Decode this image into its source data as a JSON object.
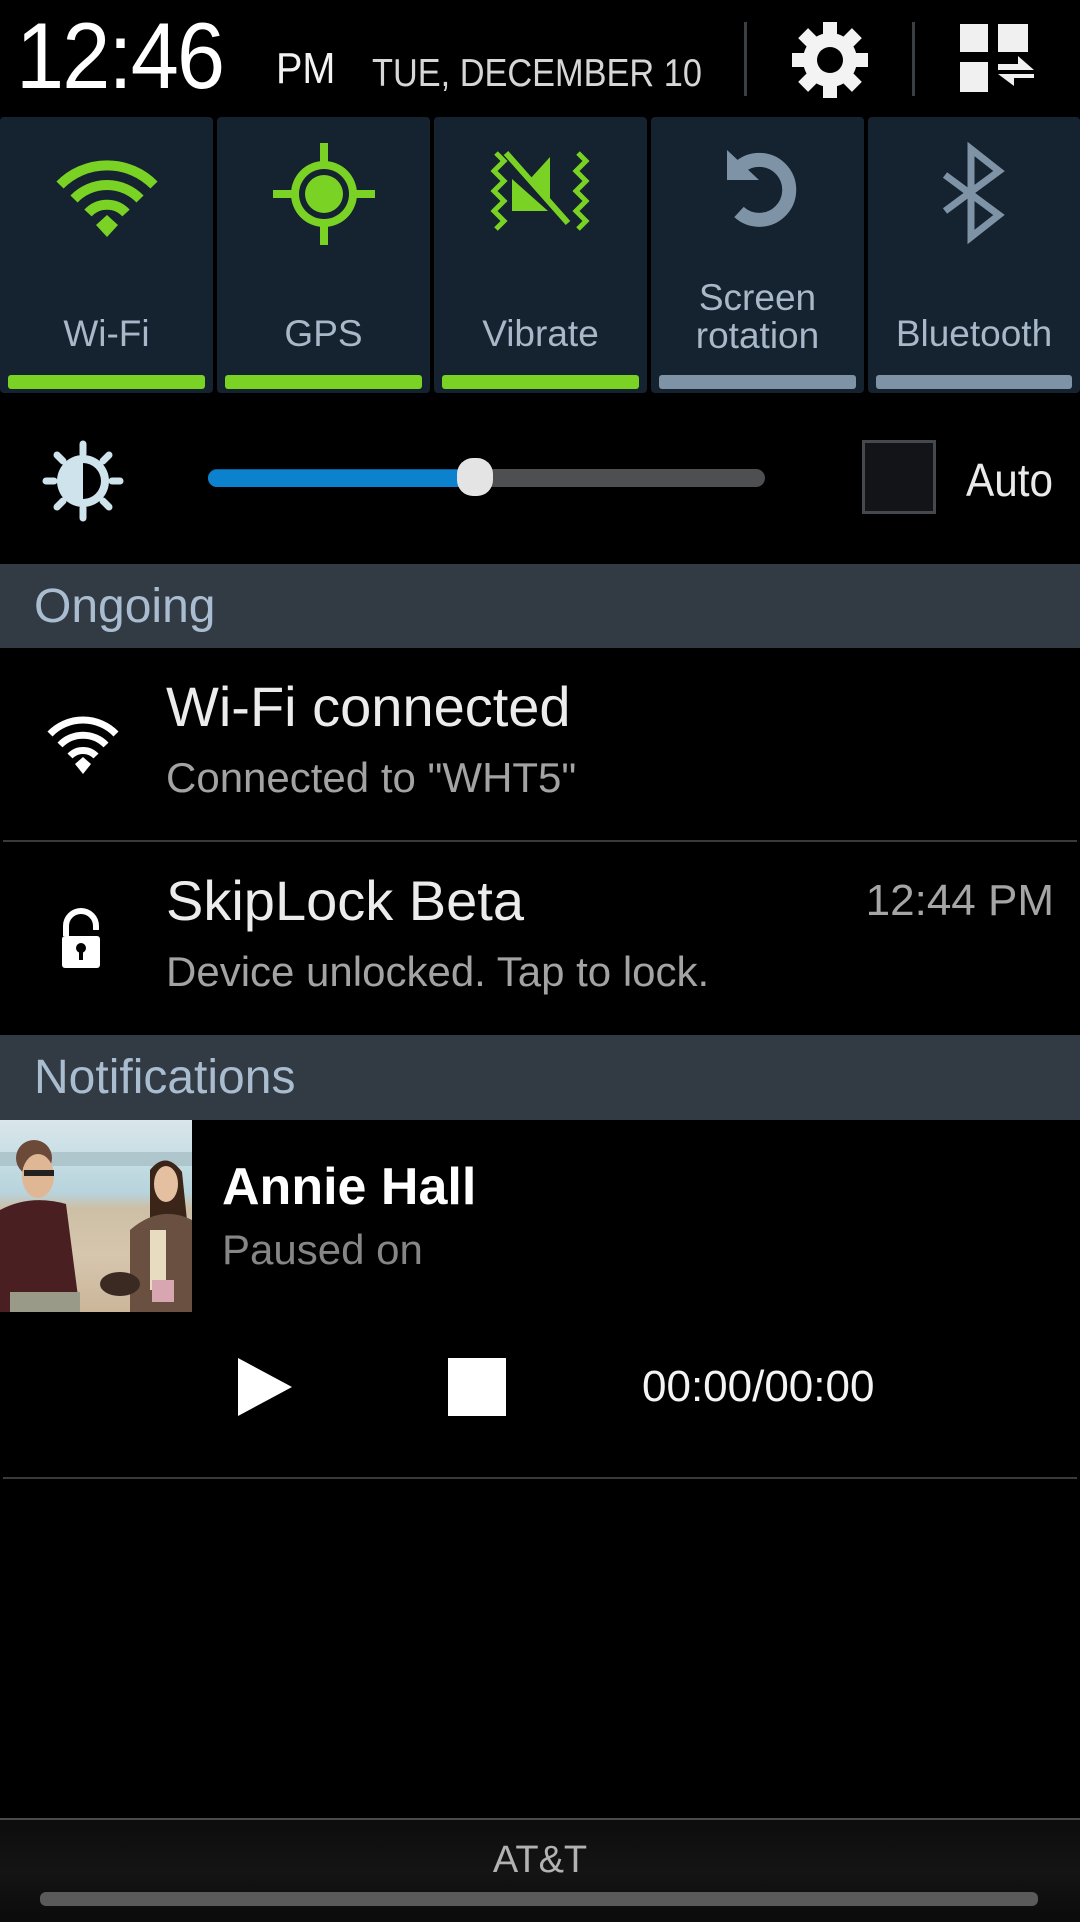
{
  "header": {
    "time": "12:46",
    "ampm": "PM",
    "date": "TUE, DECEMBER 10",
    "settings_icon": "gear-icon",
    "quick_panel_icon": "quick-panel-toggle-icon"
  },
  "quick_settings": [
    {
      "label": "Wi-Fi",
      "icon": "wifi-icon",
      "enabled": true
    },
    {
      "label": "GPS",
      "icon": "gps-icon",
      "enabled": true
    },
    {
      "label": "Vibrate",
      "icon": "vibrate-icon",
      "enabled": true
    },
    {
      "label": "Screen\nrotation",
      "label_line1": "Screen",
      "label_line2": "rotation",
      "icon": "rotation-icon",
      "enabled": false
    },
    {
      "label": "Bluetooth",
      "icon": "bluetooth-icon",
      "enabled": false
    }
  ],
  "colors": {
    "active": "#79d224",
    "inactive": "#7f93a6",
    "slider_fill": "#0c82cf",
    "section_bg": "#323b44",
    "tile_bg": "#152230"
  },
  "brightness": {
    "icon": "brightness-icon",
    "level_percent": 48,
    "auto_label": "Auto",
    "auto_checked": false
  },
  "sections": {
    "ongoing": "Ongoing",
    "notifications": "Notifications"
  },
  "ongoing": [
    {
      "icon": "wifi-icon",
      "title": "Wi-Fi connected",
      "subtitle": "Connected to \"WHT5\"",
      "time": ""
    },
    {
      "icon": "unlocked-padlock-icon",
      "title": "SkipLock Beta",
      "subtitle": "Device unlocked. Tap to lock.",
      "time": "12:44 PM"
    }
  ],
  "media": {
    "title": "Annie Hall",
    "subtitle": "Paused on",
    "time": "00:00/00:00",
    "thumbnail": "movie-still-thumbnail"
  },
  "footer": {
    "carrier": "AT&T"
  }
}
